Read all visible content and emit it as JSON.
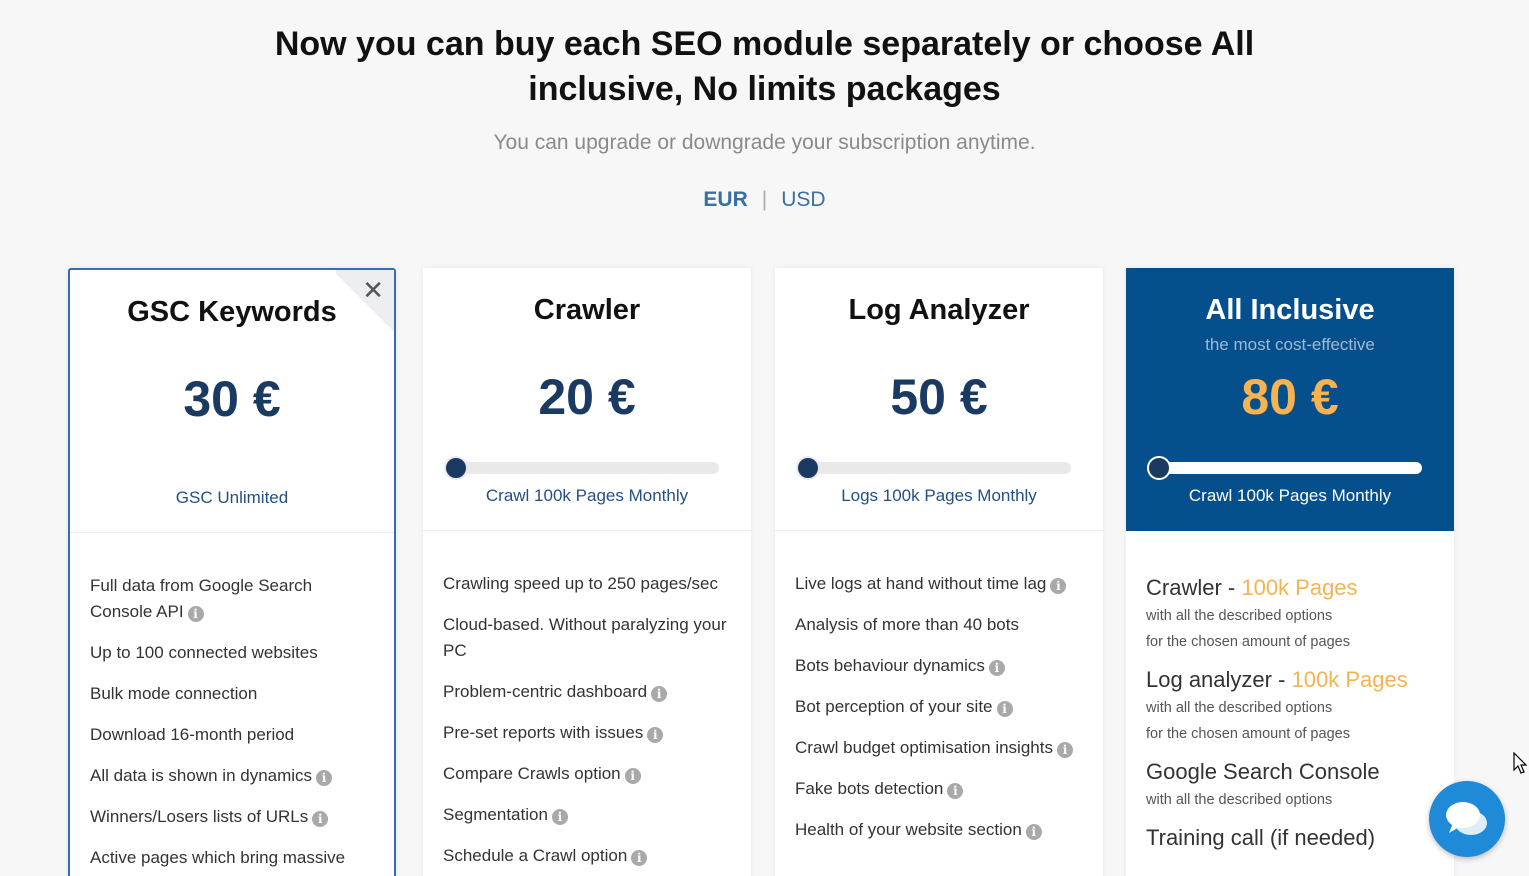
{
  "header": {
    "title_line1": "Now you can buy each SEO module separately or choose All",
    "title_line2": "inclusive, No limits packages",
    "subtitle": "You can upgrade or downgrade your subscription anytime.",
    "currency_options": [
      "EUR",
      "USD"
    ],
    "currency_selected": "EUR",
    "separator": "|"
  },
  "plans": [
    {
      "title": "GSC Keywords",
      "price": "30 €",
      "caption": "GSC Unlimited",
      "selected": true,
      "features": [
        {
          "text": "Full data from Google Search Console API",
          "info": true
        },
        {
          "text": "Up to 100 connected websites",
          "info": false
        },
        {
          "text": "Bulk mode connection",
          "info": false
        },
        {
          "text": "Download 16-month period",
          "info": false
        },
        {
          "text": "All data is shown in dynamics",
          "info": true
        },
        {
          "text": "Winners/Losers lists of URLs",
          "info": true
        },
        {
          "text": "Active pages which bring massive",
          "info": false
        }
      ]
    },
    {
      "title": "Crawler",
      "price": "20 €",
      "caption": "Crawl 100k Pages Monthly",
      "slider_level": 0.04,
      "features": [
        {
          "text": "Crawling speed up to 250 pages/sec",
          "info": false
        },
        {
          "text": "Cloud-based. Without paralyzing your PC",
          "info": false
        },
        {
          "text": "Problem-centric dashboard",
          "info": true
        },
        {
          "text": "Pre-set reports with issues",
          "info": true
        },
        {
          "text": "Compare Crawls option",
          "info": true
        },
        {
          "text": "Segmentation",
          "info": true
        },
        {
          "text": "Schedule a Crawl option",
          "info": true
        }
      ]
    },
    {
      "title": "Log Analyzer",
      "price": "50 €",
      "caption": "Logs 100k Pages Monthly",
      "slider_level": 0.04,
      "features": [
        {
          "text": "Live logs at hand without time lag",
          "info": true
        },
        {
          "text": "Analysis of more than 40 bots",
          "info": false
        },
        {
          "text": "Bots behaviour dynamics",
          "info": true
        },
        {
          "text": "Bot perception of your site",
          "info": true
        },
        {
          "text": "Crawl budget optimisation insights",
          "info": true
        },
        {
          "text": "Fake bots detection",
          "info": true
        },
        {
          "text": "Health of your website section",
          "info": true
        }
      ]
    },
    {
      "title": "All Inclusive",
      "tagline": "the most cost-effective",
      "price": "80 €",
      "caption": "Crawl 100k Pages Monthly",
      "slider_level": 0.04,
      "bundle": [
        {
          "title": "Crawler - ",
          "accent": "100k Pages",
          "notes": [
            "with all the described options",
            "for the chosen amount of pages"
          ]
        },
        {
          "title": "Log analyzer - ",
          "accent": "100k Pages",
          "notes": [
            "with all the described options",
            "for the chosen amount of pages"
          ]
        },
        {
          "title": "Google Search Console",
          "accent": "",
          "notes": [
            "with all the described options"
          ]
        },
        {
          "title": "Training call (if needed)",
          "accent": "",
          "notes": []
        }
      ]
    }
  ],
  "colors": {
    "accent": "#3a6bb0",
    "navy": "#1b3a62",
    "highlight_bg": "#05508c",
    "orange": "#f5b351",
    "chat": "#1e8ad8"
  },
  "icons": {
    "close": "close-icon",
    "info": "info-icon",
    "chat": "chat-icon",
    "cursor": "cursor-icon"
  }
}
